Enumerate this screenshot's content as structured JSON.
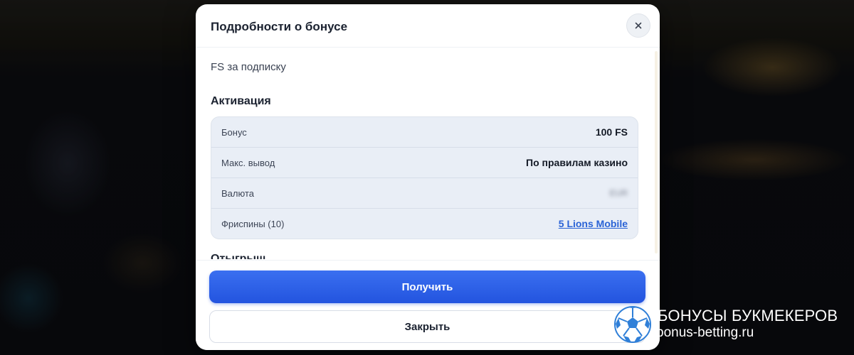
{
  "modal": {
    "title": "Подробности о бонусе",
    "subtitle": "FS за подписку",
    "close_label": "×",
    "sections": {
      "activation": "Активация",
      "wager": "Отыгрыш"
    },
    "rows": [
      {
        "label": "Бонус",
        "value": "100 FS"
      },
      {
        "label": "Макс. вывод",
        "value": "По правилам казино"
      },
      {
        "label": "Валюта",
        "value": "EUR"
      },
      {
        "label": "Фриспины (10)",
        "value": "5 Lions Mobile"
      }
    ],
    "buttons": {
      "claim": "Получить",
      "close": "Закрыть"
    }
  },
  "watermark": {
    "line1": "БОНУСЫ БУКМЕКЕРОВ",
    "line2": "bonus-betting.ru"
  },
  "colors": {
    "primary": "#2354df",
    "link": "#2a63d6",
    "table_bg": "#e9eef6"
  }
}
